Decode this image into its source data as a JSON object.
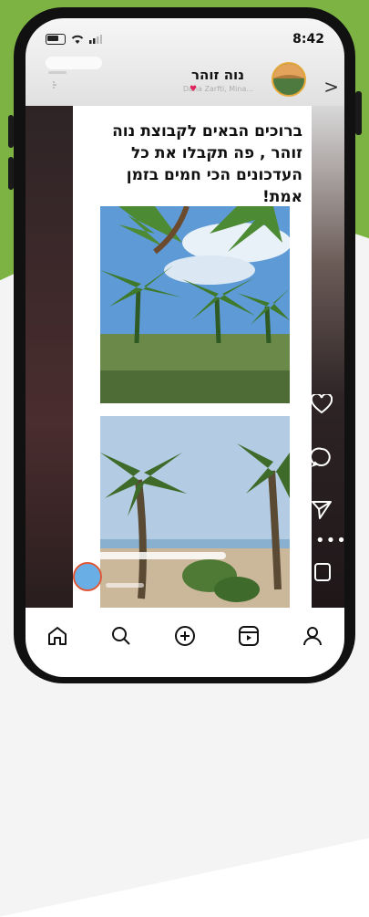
{
  "status_bar": {
    "time": "8:42"
  },
  "header": {
    "account_name": "נוה זוהר",
    "subtitle": "Dana Zarfti, Mina..."
  },
  "post": {
    "caption": "ברוכים הבאים לקבוצת נוה זוהר , פה תקבלו את כל העדכונים הכי חמים בזמן אמת!"
  },
  "actions": [
    {
      "name": "like",
      "icon": "heart-icon"
    },
    {
      "name": "comment",
      "icon": "comment-icon"
    },
    {
      "name": "share",
      "icon": "send-icon"
    },
    {
      "name": "more",
      "icon": "more-icon"
    },
    {
      "name": "save",
      "icon": "bookmark-icon"
    }
  ],
  "bottom_nav": [
    {
      "name": "home",
      "icon": "home-icon"
    },
    {
      "name": "search",
      "icon": "search-icon"
    },
    {
      "name": "create",
      "icon": "plus-icon"
    },
    {
      "name": "reels",
      "icon": "reels-icon"
    },
    {
      "name": "profile",
      "icon": "profile-icon"
    }
  ],
  "colors": {
    "background_green": "#7db343",
    "avatar_ring": "#e7a93a",
    "like_accent": "#e0245e",
    "slider_thumb": "#6aaee6"
  }
}
